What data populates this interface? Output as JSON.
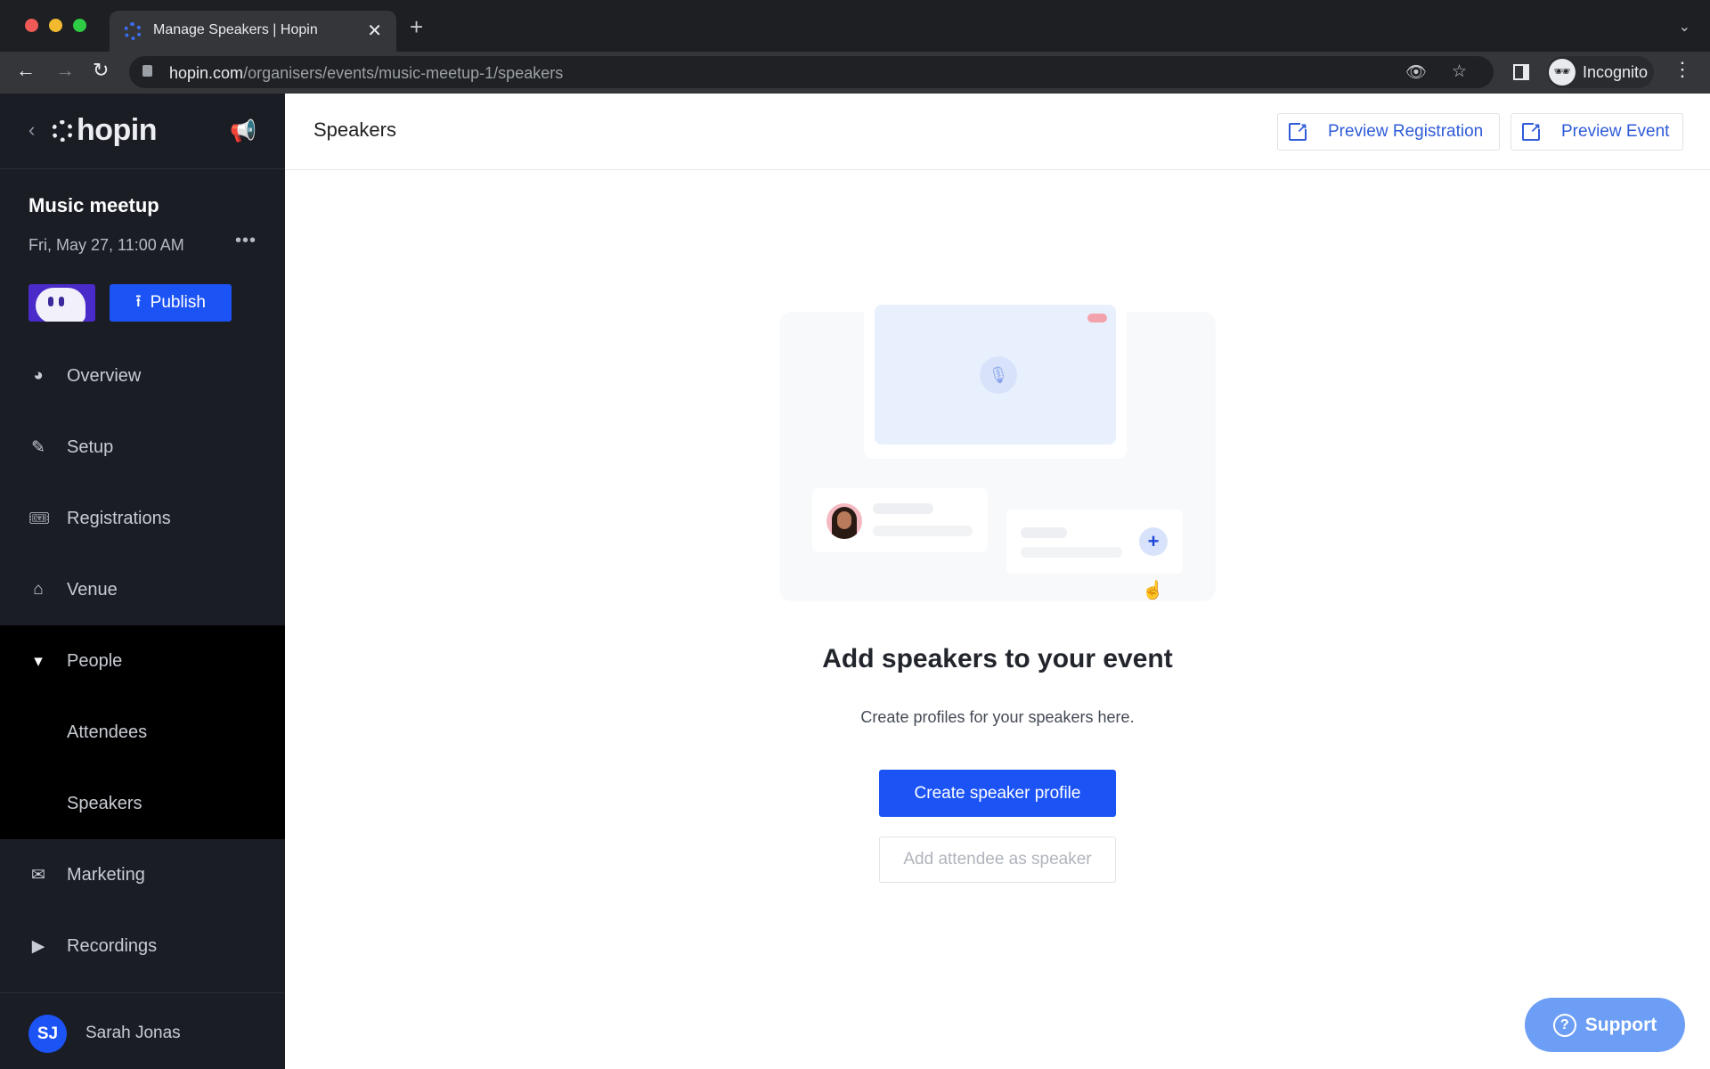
{
  "browser": {
    "tab_title": "Manage Speakers | Hopin",
    "tab_close": "✕",
    "new_tab": "+",
    "tab_list": "⌄",
    "back": "←",
    "forward": "→",
    "reload": "↻",
    "url_host": "hopin.com",
    "url_path": "/organisers/events/music-meetup-1/speakers",
    "eye_off_icon": "👁",
    "star_icon": "☆",
    "incognito_avatar": "🕶",
    "incognito_label": "Incognito",
    "menu": "⋮"
  },
  "sidebar": {
    "back": "‹",
    "logo": "hopin",
    "announce_icon": "📢",
    "event_name": "Music meetup",
    "event_date": "Fri, May 27, 11:00 AM",
    "more": "•••",
    "publish_icon": "⭱",
    "publish_label": "Publish",
    "items": [
      {
        "label": "Overview",
        "icon": "◕"
      },
      {
        "label": "Setup",
        "icon": "✎"
      },
      {
        "label": "Registrations",
        "icon": "🎟"
      },
      {
        "label": "Venue",
        "icon": "⌂"
      },
      {
        "label": "People",
        "icon": "▾"
      },
      {
        "label": "Marketing",
        "icon": "✉"
      },
      {
        "label": "Recordings",
        "icon": "▶"
      }
    ],
    "people_children": [
      {
        "label": "Attendees"
      },
      {
        "label": "Speakers"
      }
    ],
    "user": {
      "initials": "SJ",
      "name": "Sarah Jonas"
    }
  },
  "main": {
    "title": "Speakers",
    "preview_registration": "Preview Registration",
    "preview_event": "Preview Event",
    "ext_glyph": "↗",
    "illustration": {
      "mic_icon": "🎙",
      "plus_icon": "+"
    },
    "cursor": "☝",
    "empty_title": "Add speakers to your event",
    "empty_subtitle": "Create profiles for your speakers here.",
    "create_button": "Create speaker profile",
    "add_attendee_button": "Add attendee as speaker",
    "support_icon": "?",
    "support_label": "Support"
  },
  "colors": {
    "brand_blue": "#1c53f5",
    "sidebar_bg": "#1b1d25",
    "support_bg": "#6d9ef5"
  }
}
